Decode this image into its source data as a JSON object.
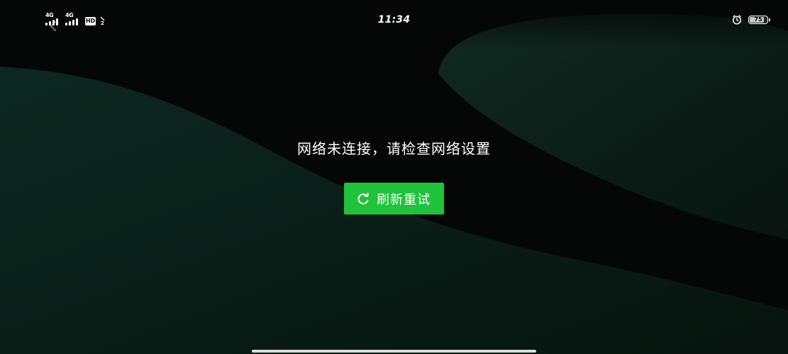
{
  "status_bar": {
    "time": "11:34",
    "network_1": "4G",
    "network_2": "4G",
    "hd_label": "HD",
    "hd_subscript": "2",
    "battery_level": "75",
    "battery_percent": 75,
    "icons": [
      "signal-icon",
      "hd-icon",
      "alarm-icon",
      "battery-icon"
    ]
  },
  "content": {
    "error_message": "网络未连接，请检查网络设置",
    "retry_button": {
      "label": "刷新重试",
      "icon": "refresh-icon"
    }
  },
  "colors": {
    "button": "#1fc23a",
    "background": "#050807",
    "text": "#ffffff"
  }
}
